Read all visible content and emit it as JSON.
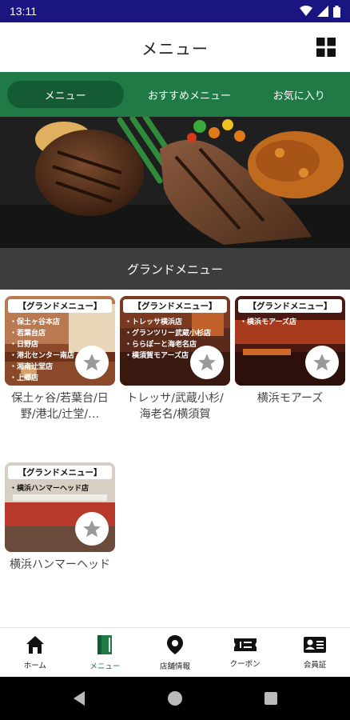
{
  "status_bar": {
    "time": "13:11"
  },
  "app_bar": {
    "title": "メニュー"
  },
  "tabs": [
    {
      "label": "メニュー",
      "active": true
    },
    {
      "label": "おすすめメニュー",
      "active": false
    },
    {
      "label": "お気に入り",
      "active": false
    }
  ],
  "section": {
    "title": "グランドメニュー"
  },
  "cards": [
    {
      "badge": "【グランドメニュー】",
      "lines": [
        "・保土ヶ谷本店",
        "・若葉台店",
        "・日野店",
        "・港北センター南店",
        "・湘南辻堂店",
        "・上郷店"
      ],
      "label": "保土ヶ谷/若葉台/日野/港北/辻堂/…"
    },
    {
      "badge": "【グランドメニュー】",
      "lines": [
        "・トレッサ横浜店",
        "・グランツリー武蔵小杉店",
        "・ららぽーと海老名店",
        "・横須賀モアーズ店"
      ],
      "label": "トレッサ/武蔵小杉/海老名/横須賀"
    },
    {
      "badge": "【グランドメニュー】",
      "lines": [
        "・横浜モアーズ店"
      ],
      "label": "横浜モアーズ"
    },
    {
      "badge": "【グランドメニュー】",
      "lines": [
        "・横浜ハンマーヘッド店"
      ],
      "label": "横浜ハンマーヘッド"
    }
  ],
  "bottom_nav": [
    {
      "label": "ホーム",
      "icon": "home-icon"
    },
    {
      "label": "メニュー",
      "icon": "book-icon",
      "active": true
    },
    {
      "label": "店舗情報",
      "icon": "location-pin-icon"
    },
    {
      "label": "クーポン",
      "icon": "ticket-icon"
    },
    {
      "label": "会員証",
      "icon": "member-card-icon"
    }
  ],
  "colors": {
    "status_bar": "#1a1580",
    "tab_bar": "#1f7a45",
    "tab_active": "#145a32",
    "section_bar": "#3d3d3d"
  }
}
